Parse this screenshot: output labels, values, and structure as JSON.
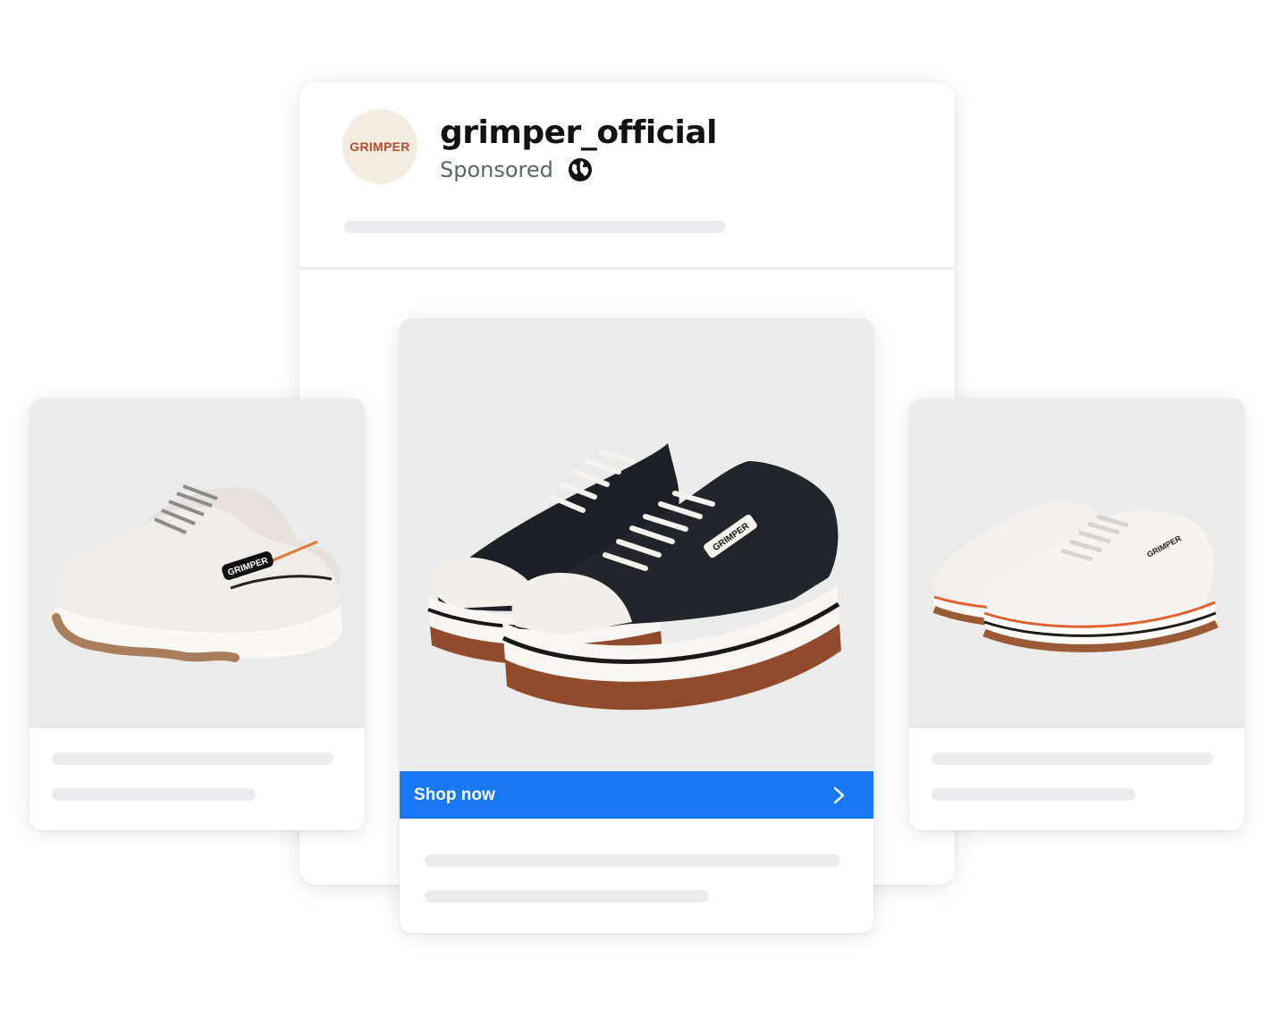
{
  "post": {
    "brand_logo_text": "GRIMPER",
    "account_name": "grimper_official",
    "sponsored_label": "Sponsored",
    "audience_icon": "globe-icon"
  },
  "carousel": {
    "cards": [
      {
        "product": "chunky white sneaker",
        "shoe_logo_text": "GRIMPER"
      },
      {
        "product": "black platform canvas sneaker",
        "shoe_logo_text": "GRIMPER",
        "cta_label": "Shop now",
        "cta_icon": "chevron-right-icon",
        "cta_color": "#1877f2"
      },
      {
        "product": "white platform canvas sneaker",
        "shoe_logo_text": "GRIMPER"
      }
    ]
  },
  "colors": {
    "accent": "#1877f2",
    "brand": "#b94a2c",
    "skeleton": "#ececef",
    "image_background": "#ebebeb"
  }
}
